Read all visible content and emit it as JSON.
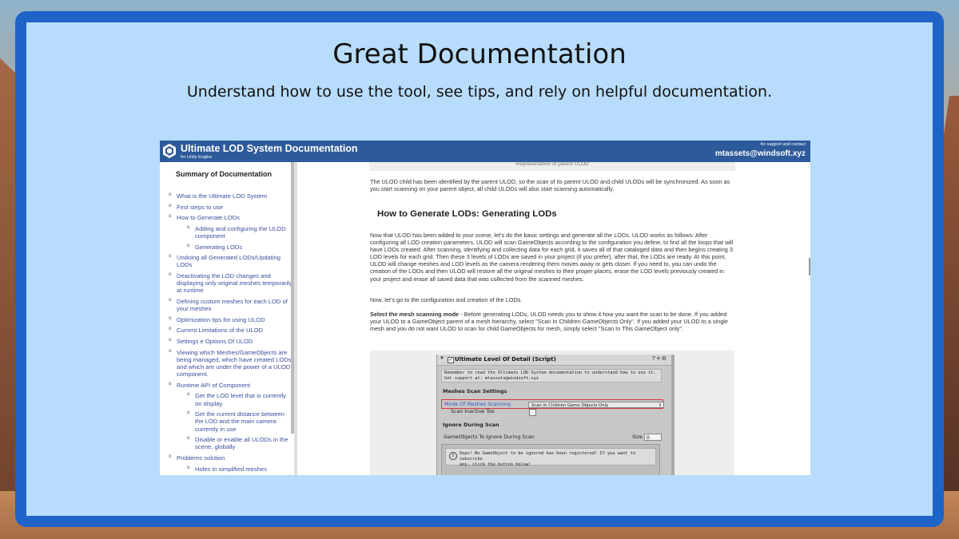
{
  "heading": {
    "title": "Great Documentation",
    "subtitle": "Understand how to use the tool, see tips, and rely on helpful documentation."
  },
  "doc": {
    "header": {
      "title": "Ultimate LOD System Documentation",
      "subtitle": "for Unity Engine",
      "contact_small": "for support and contact",
      "contact_email": "mtassets@windsoft.xyz"
    },
    "sidebar": {
      "summary_title": "Summary of Documentation",
      "items": [
        {
          "label": "What is the Ultimate LOD System",
          "level": 1
        },
        {
          "label": "First steps to use",
          "level": 1
        },
        {
          "label": "How to Generate LODs",
          "level": 1
        },
        {
          "label": "Adding and configuring the ULOD component",
          "level": 2
        },
        {
          "label": "Generating LODs",
          "level": 2
        },
        {
          "label": "Undoing all Generated LODs/Updating LODs",
          "level": 1
        },
        {
          "label": "Deactivating the LOD changes and displaying only original meshes temporarily at runtime",
          "level": 1
        },
        {
          "label": "Defining custom meshes for each LOD of your meshes",
          "level": 1
        },
        {
          "label": "Optimization tips for using ULOD",
          "level": 1
        },
        {
          "label": "Current Limitations of the ULOD",
          "level": 1
        },
        {
          "label": "Settings e Options Of ULOD",
          "level": 1
        },
        {
          "label": "Viewing which Meshes/GameObjects are being managed, which have created LODs and which are under the power of a ULOD component.",
          "level": 1
        },
        {
          "label": "Runtime API of Component",
          "level": 1
        },
        {
          "label": "Get the LOD level that is currently on display",
          "level": 2
        },
        {
          "label": "Get the current distance between the LOD and the main camera currently in use",
          "level": 2
        },
        {
          "label": "Disable or enable all ULODs in the scene, globally",
          "level": 2
        },
        {
          "label": "Problems solution",
          "level": 1
        },
        {
          "label": "Holes in simplified meshes",
          "level": 2
        }
      ]
    },
    "content": {
      "top_caption": "Representation of parent ULOD",
      "para_child": "The ULOD child has been identified by the parent ULOD, so the scan of its parent ULOD and child ULODs will be synchronized. As soon as you start scanning on your parent object, all child ULODs will also start scanning automatically.",
      "section_title": "How to Generate LODs: Generating LODs",
      "para_intro": "Now that ULOD has been added to your scene, let's do the basic settings and generate all the LODs. ULOD works as follows: After configuring all LOD creation parameters, ULOD will scan GameObjects according to the configuration you define, to find all the loops that will have LODs created. After scanning, identifying and collecting data for each grid, it saves all of that cataloged data and then begins creating 3 LOD levels for each grid. Then these 3 levels of LODs are saved in your project (if you prefer), after that, the LODs are ready. At this point, ULOD will change meshes and LOD levels as the camera rendering them moves away or gets closer. If you need to, you can undo the creation of the LODs and then ULOD will restore all the original meshes to their proper places, erase the LOD levels previously created in your project and erase all saved data that was collected from the scanned meshes.",
      "para_go": "Now, let's go to the configuration and creation of the LODs.",
      "para_mode_bold": "Select the mesh scanning mode",
      "para_mode_rest": " - Before generating LODs, ULOD needs you to show it how you want the scan to be done. If you added your ULOD to a GameObject parent of a mesh hierarchy, select \"Scan In Children GameObjects Only\". If you added your ULOD to a single mesh and you do not want ULOD to scan for child GameObjects for mesh, simply select \"Scan In This GameObject only\"."
    },
    "inspector": {
      "title": "Ultimate Level Of Detail (Script)",
      "note_line1": "Remember to read the Ultimate LOD System documentation to understand how to use it.",
      "note_line2": "Get support at: mtassets@windsoft.xyz",
      "section_scan": "Meshes Scan Settings",
      "mode_label": "Mode Of Meshes Scanning",
      "mode_value": "Scan In Children Game Objects Only",
      "inactive_label": "Scan Inactive Too",
      "section_ignore": "Ignore During Scan",
      "ignore_label": "GameObjects To Ignore During Scan",
      "size_label": "Size",
      "size_value": "0",
      "warning_line1": "Oops! No GameObject to be ignored has been registered! If you want to subscribe",
      "warning_line2": "any, click the button below!",
      "header_icons": "? ≡ ⚙"
    }
  }
}
